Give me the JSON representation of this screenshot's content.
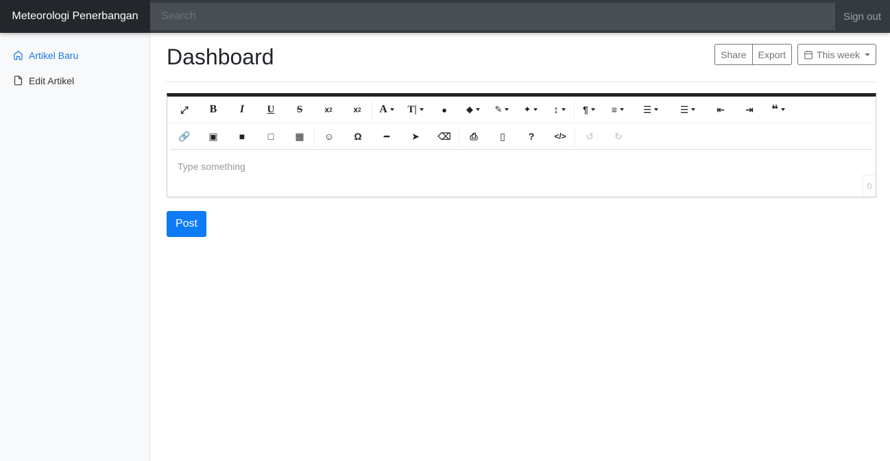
{
  "navbar": {
    "brand": "Meteorologi Penerbangan",
    "search_placeholder": "Search",
    "signout": "Sign out"
  },
  "sidebar": {
    "items": [
      {
        "label": "Artikel Baru",
        "icon": "home-icon",
        "active": true
      },
      {
        "label": "Edit Artikel",
        "icon": "file-icon",
        "active": false
      }
    ]
  },
  "main": {
    "title": "Dashboard",
    "share_label": "Share",
    "export_label": "Export",
    "range_label": "This week"
  },
  "editor": {
    "row1": [
      "fullscreen-icon",
      "bold-icon",
      "italic-icon",
      "underline-icon",
      "strikethrough-icon",
      "subscript-icon",
      "superscript-icon",
      "font-family-icon",
      "font-size-icon",
      "color-icon",
      "tag-icon",
      "paint-brush-icon",
      "magic-wand-icon",
      "line-height-icon",
      "paragraph-icon",
      "align-icon",
      "ordered-list-icon",
      "unordered-list-icon",
      "outdent-icon",
      "indent-icon",
      "quote-icon"
    ],
    "row2": [
      "link-icon",
      "image-icon",
      "video-icon",
      "file-icon",
      "table-icon",
      "emoticon-icon",
      "special-char-icon",
      "horizontal-line-icon",
      "select-all-icon",
      "clear-format-icon",
      "print-icon",
      "pdf-icon",
      "help-icon",
      "code-view-icon",
      "undo-icon",
      "redo-icon"
    ],
    "placeholder": "Type something",
    "char_count": "0"
  },
  "post_label": "Post",
  "colors": {
    "accent": "#0d7bf5",
    "navbar": "#343a40",
    "brand_bg": "#23272b"
  }
}
